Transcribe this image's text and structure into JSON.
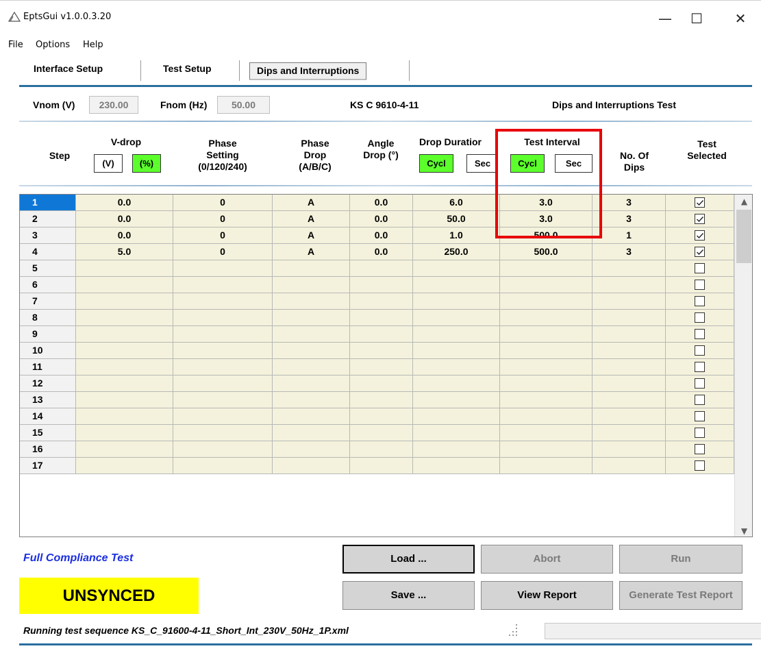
{
  "window": {
    "title": "EptsGui v1.0.0.3.20",
    "minimize_glyph": "—",
    "maximize_glyph": "☐",
    "close_glyph": "✕"
  },
  "menu": [
    "File",
    "Options",
    "Help"
  ],
  "tabs": [
    {
      "label": "Interface Setup",
      "active": false
    },
    {
      "label": "Test Setup",
      "active": false
    },
    {
      "label": "Dips and Interruptions",
      "active": true
    }
  ],
  "info": {
    "vnom_label": "Vnom (V)",
    "vnom_value": "230.00",
    "fnom_label": "Fnom (Hz)",
    "fnom_value": "50.00",
    "standard": "KS C 9610-4-11",
    "test_name": "Dips and Interruptions Test"
  },
  "columns": {
    "step": "Step",
    "vdrop": "V-drop",
    "vdrop_v": "(V)",
    "vdrop_pct": "(%)",
    "phase_setting_1": "Phase",
    "phase_setting_2": "Setting",
    "phase_setting_3": "(0/120/240)",
    "phase_drop_1": "Phase",
    "phase_drop_2": "Drop",
    "phase_drop_3": "(A/B/C)",
    "angle_1": "Angle",
    "angle_2": "Drop (°)",
    "drop_duration": "Drop Duratior",
    "dd_cycl": "Cycl",
    "dd_sec": "Sec",
    "test_interval": "Test Interval",
    "ti_cycl": "Cycl",
    "ti_sec": "Sec",
    "dips_1": "No. Of",
    "dips_2": "Dips",
    "selected_1": "Test",
    "selected_2": "Selected"
  },
  "rows": [
    {
      "step": "1",
      "vdrop": "0.0",
      "phase_setting": "0",
      "phase_drop": "A",
      "angle": "0.0",
      "duration": "6.0",
      "interval": "3.0",
      "dips": "3",
      "checked": true
    },
    {
      "step": "2",
      "vdrop": "0.0",
      "phase_setting": "0",
      "phase_drop": "A",
      "angle": "0.0",
      "duration": "50.0",
      "interval": "3.0",
      "dips": "3",
      "checked": true
    },
    {
      "step": "3",
      "vdrop": "0.0",
      "phase_setting": "0",
      "phase_drop": "A",
      "angle": "0.0",
      "duration": "1.0",
      "interval": "500.0",
      "dips": "1",
      "checked": true
    },
    {
      "step": "4",
      "vdrop": "5.0",
      "phase_setting": "0",
      "phase_drop": "A",
      "angle": "0.0",
      "duration": "250.0",
      "interval": "500.0",
      "dips": "3",
      "checked": true
    },
    {
      "step": "5",
      "vdrop": "",
      "phase_setting": "",
      "phase_drop": "",
      "angle": "",
      "duration": "",
      "interval": "",
      "dips": "",
      "checked": false
    },
    {
      "step": "6",
      "vdrop": "",
      "phase_setting": "",
      "phase_drop": "",
      "angle": "",
      "duration": "",
      "interval": "",
      "dips": "",
      "checked": false
    },
    {
      "step": "7",
      "vdrop": "",
      "phase_setting": "",
      "phase_drop": "",
      "angle": "",
      "duration": "",
      "interval": "",
      "dips": "",
      "checked": false
    },
    {
      "step": "8",
      "vdrop": "",
      "phase_setting": "",
      "phase_drop": "",
      "angle": "",
      "duration": "",
      "interval": "",
      "dips": "",
      "checked": false
    },
    {
      "step": "9",
      "vdrop": "",
      "phase_setting": "",
      "phase_drop": "",
      "angle": "",
      "duration": "",
      "interval": "",
      "dips": "",
      "checked": false
    },
    {
      "step": "10",
      "vdrop": "",
      "phase_setting": "",
      "phase_drop": "",
      "angle": "",
      "duration": "",
      "interval": "",
      "dips": "",
      "checked": false
    },
    {
      "step": "11",
      "vdrop": "",
      "phase_setting": "",
      "phase_drop": "",
      "angle": "",
      "duration": "",
      "interval": "",
      "dips": "",
      "checked": false
    },
    {
      "step": "12",
      "vdrop": "",
      "phase_setting": "",
      "phase_drop": "",
      "angle": "",
      "duration": "",
      "interval": "",
      "dips": "",
      "checked": false
    },
    {
      "step": "13",
      "vdrop": "",
      "phase_setting": "",
      "phase_drop": "",
      "angle": "",
      "duration": "",
      "interval": "",
      "dips": "",
      "checked": false
    },
    {
      "step": "14",
      "vdrop": "",
      "phase_setting": "",
      "phase_drop": "",
      "angle": "",
      "duration": "",
      "interval": "",
      "dips": "",
      "checked": false
    },
    {
      "step": "15",
      "vdrop": "",
      "phase_setting": "",
      "phase_drop": "",
      "angle": "",
      "duration": "",
      "interval": "",
      "dips": "",
      "checked": false
    },
    {
      "step": "16",
      "vdrop": "",
      "phase_setting": "",
      "phase_drop": "",
      "angle": "",
      "duration": "",
      "interval": "",
      "dips": "",
      "checked": false
    },
    {
      "step": "17",
      "vdrop": "",
      "phase_setting": "",
      "phase_drop": "",
      "angle": "",
      "duration": "",
      "interval": "",
      "dips": "",
      "checked": false
    }
  ],
  "scroll_up_glyph": "▲",
  "scroll_down_glyph": "▼",
  "mode_label": "Full Compliance Test",
  "sync_status": "UNSYNCED",
  "buttons": {
    "load": "Load ...",
    "abort": "Abort",
    "run": "Run",
    "save": "Save ...",
    "view_report": "View Report",
    "generate_report": "Generate Test Report"
  },
  "status_message": "Running test sequence  KS_C_91600-4-11_Short_Int_230V_50Hz_1P.xml",
  "colors": {
    "accent_rule": "#2a6fa0",
    "unit_on": "#5cff2c",
    "sync_bg": "#ffff00",
    "highlight": "#e8000b",
    "mode_text": "#1c2fe0",
    "selected_row": "#0f78d7"
  }
}
